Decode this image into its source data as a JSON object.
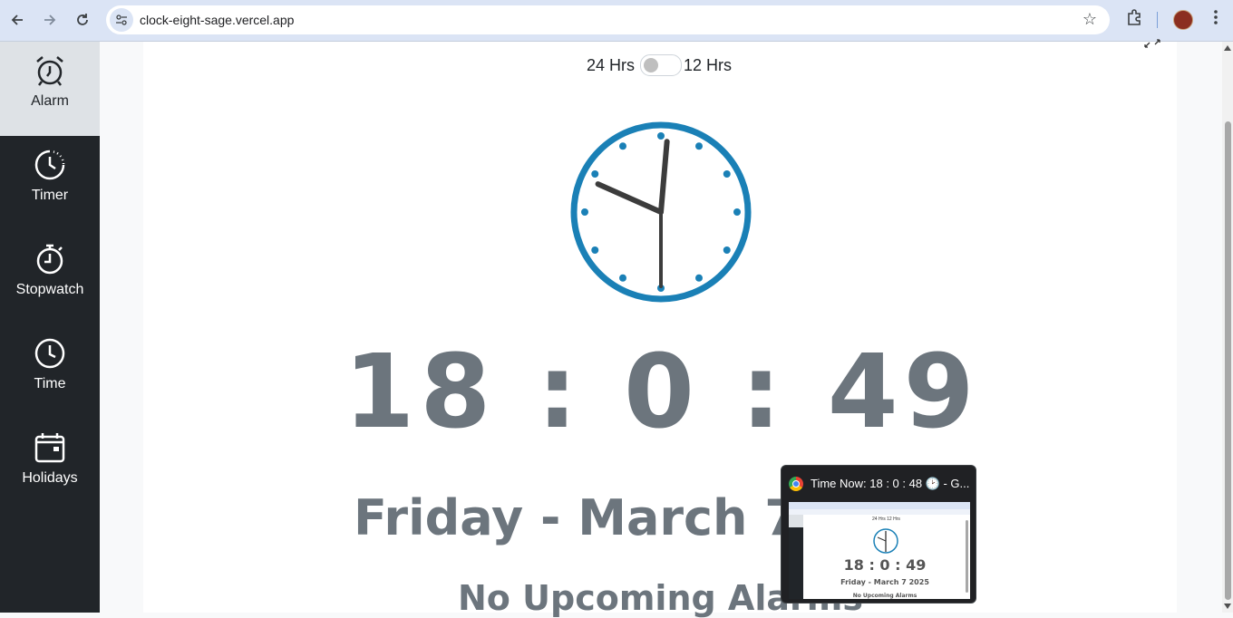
{
  "browser": {
    "url": "clock-eight-sage.vercel.app",
    "back_icon": "arrow-left-icon",
    "forward_icon": "arrow-right-icon",
    "reload_icon": "reload-icon",
    "bookmark_icon": "star-icon",
    "extensions_icon": "puzzle-icon",
    "menu_icon": "kebab-menu-icon"
  },
  "sidebar": {
    "items": [
      {
        "label": "Alarm",
        "icon": "alarm-clock-icon",
        "active": true
      },
      {
        "label": "Timer",
        "icon": "timer-icon",
        "active": false
      },
      {
        "label": "Stopwatch",
        "icon": "stopwatch-icon",
        "active": false
      },
      {
        "label": "Time",
        "icon": "clock-icon",
        "active": false
      },
      {
        "label": "Holidays",
        "icon": "calendar-icon",
        "active": false
      }
    ]
  },
  "main": {
    "toggle": {
      "left_label": "24 Hrs",
      "right_label": "12 Hrs",
      "is_12h": false
    },
    "analog_clock": {
      "hour": 18,
      "minute": 0,
      "second": 49,
      "color": "#1a80b6",
      "hand_color": "#3c3c3c"
    },
    "digital_time": "18 : 0 : 49",
    "date": "Friday - March 7",
    "alarms_status": "No Upcoming Alarms",
    "text_color": "#6c757d"
  },
  "tab_preview": {
    "title": "Time Now: 18 : 0 : 48 🕑 - G...",
    "thumb_toggle": "24 Hrs  12 Hrs",
    "thumb_time": "18 : 0 : 49",
    "thumb_date": "Friday - March 7 2025",
    "thumb_alarms": "No Upcoming Alarms"
  }
}
